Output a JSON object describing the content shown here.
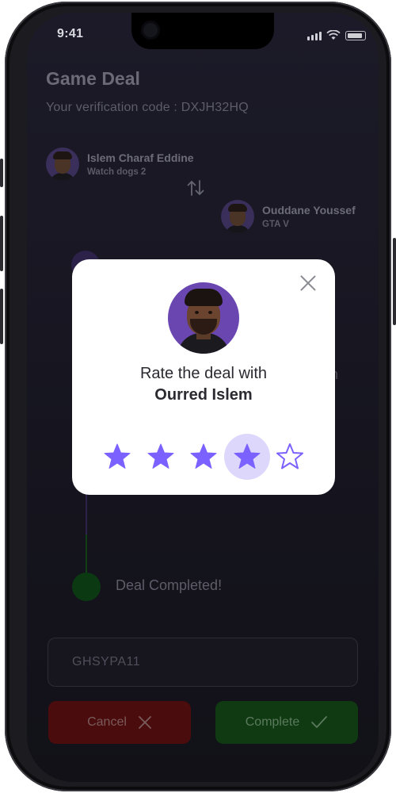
{
  "status_bar": {
    "time": "9:41"
  },
  "header": {
    "title": "Game Deal",
    "verification_label": "Your verification code : DXJH32HQ"
  },
  "players": [
    {
      "name": "Islem Charaf Eddine",
      "game": "Watch dogs 2"
    },
    {
      "name": "Ouddane Youssef",
      "game": "GTA V"
    }
  ],
  "timeline": {
    "completed_label": "Deal Completed!",
    "partial_text": "n"
  },
  "code_input": {
    "value": "GHSYPA11"
  },
  "buttons": {
    "cancel": "Cancel",
    "complete": "Complete"
  },
  "modal": {
    "title_line1": "Rate the deal with",
    "title_line2": "Ourred Islem",
    "rating": 4,
    "max_rating": 5,
    "star_color": "#7b61ff",
    "selected_bg": "#dcd7fb"
  },
  "icons": [
    "swap-arrows-icon",
    "close-icon",
    "cancel-x-icon",
    "checkmark-icon",
    "star-icon"
  ]
}
